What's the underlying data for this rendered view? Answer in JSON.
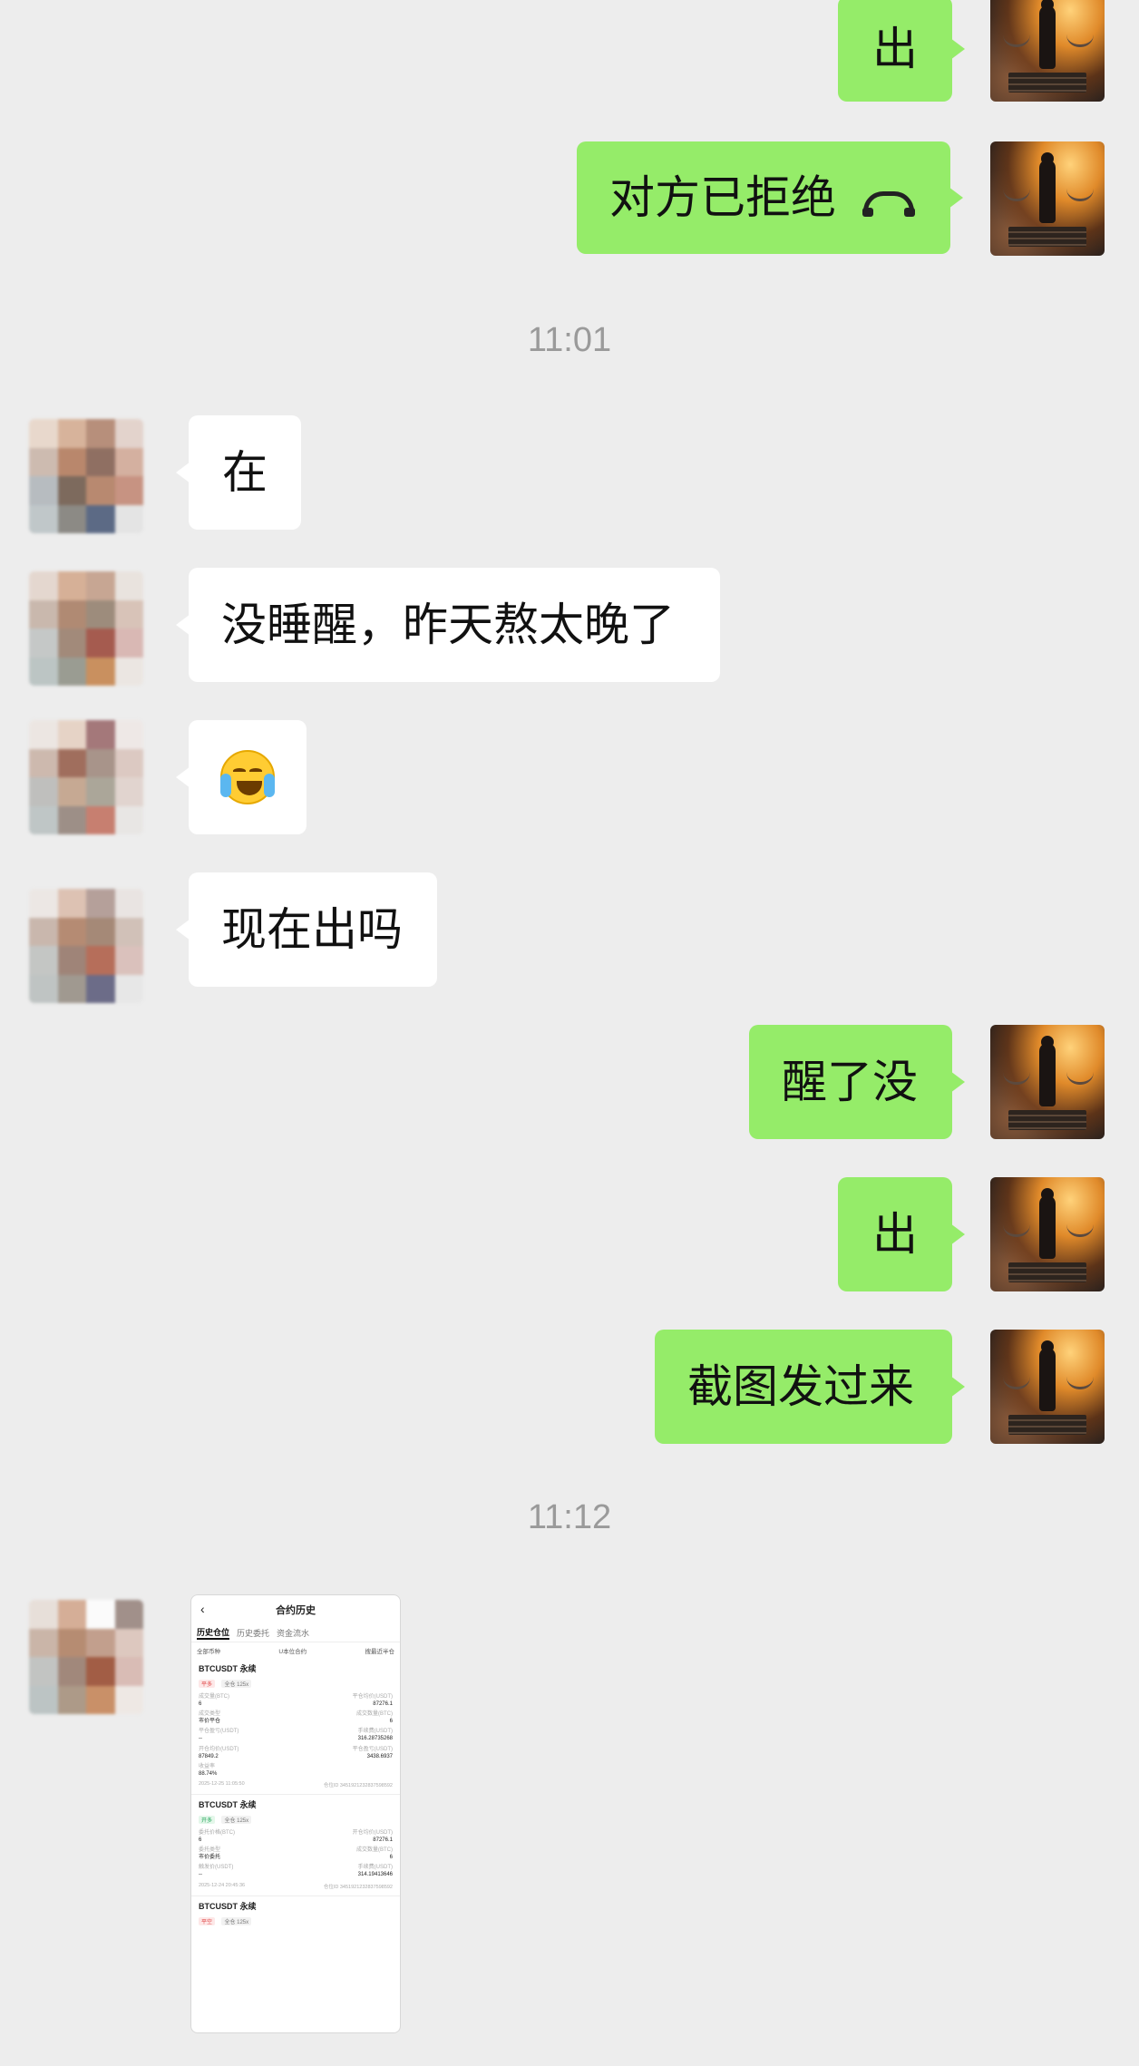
{
  "conversation": {
    "messages": [
      {
        "sender": "self",
        "text": "出"
      },
      {
        "sender": "self",
        "text": "对方已拒绝",
        "icon": "hangup-phone-icon"
      },
      {
        "sender": "other",
        "text": "在"
      },
      {
        "sender": "other",
        "text": "没睡醒，昨天熬太晚了"
      },
      {
        "sender": "other",
        "emoji": "crying-face-emoji"
      },
      {
        "sender": "other",
        "text": "现在出吗"
      },
      {
        "sender": "self",
        "text": "醒了没"
      },
      {
        "sender": "self",
        "text": "出"
      },
      {
        "sender": "self",
        "text": "截图发过来"
      },
      {
        "sender": "other",
        "image": "contract-history-screenshot"
      }
    ],
    "timestamps": [
      "11:01",
      "11:12"
    ]
  },
  "screenshot": {
    "title": "合约历史",
    "tabs": [
      "历史仓位",
      "历史委托",
      "资金流水"
    ],
    "filters": [
      "全部币种",
      "U本位合约",
      "搜最近半仓"
    ],
    "cards": [
      {
        "title": "BTCUSDT 永续",
        "tags": [
          "平多",
          "全仓 125x"
        ],
        "rows": [
          [
            "成交量(BTC)",
            "6",
            "平仓均价(USDT)",
            "87276.1"
          ],
          [
            "成交类型",
            "市价平仓",
            "成交数量(BTC)",
            "6"
          ],
          [
            "平仓盈亏(USDT)",
            "--",
            "手续费(USDT)",
            "316.28735268"
          ],
          [
            "开仓均价(USDT)",
            "87849.2",
            "平仓盈亏(USDT)",
            "3438.6937"
          ],
          [
            "收益率",
            "88.74%",
            "",
            ""
          ]
        ],
        "footer": [
          "2025-12-25 11:05:50",
          "仓位ID 3451921232837598592"
        ]
      },
      {
        "title": "BTCUSDT 永续",
        "tags": [
          "开多",
          "全仓 125x"
        ],
        "rows": [
          [
            "委托价格(BTC)",
            "6",
            "开仓均价(USDT)",
            "87276.1"
          ],
          [
            "委托类型",
            "市价委托",
            "成交数量(BTC)",
            "6"
          ],
          [
            "触发价(USDT)",
            "--",
            "手续费(USDT)",
            "314.19413646"
          ]
        ],
        "footer": [
          "2025-12-24 20:45:36",
          "仓位ID 3451921232837598592"
        ]
      },
      {
        "title": "BTCUSDT 永续",
        "tags": [
          "平空",
          "全仓 125x"
        ],
        "rows": [],
        "footer": []
      }
    ]
  },
  "colors": {
    "background": "#ededed",
    "self_bubble": "#95ec69",
    "other_bubble": "#ffffff",
    "timestamp": "#9a9a9a"
  }
}
